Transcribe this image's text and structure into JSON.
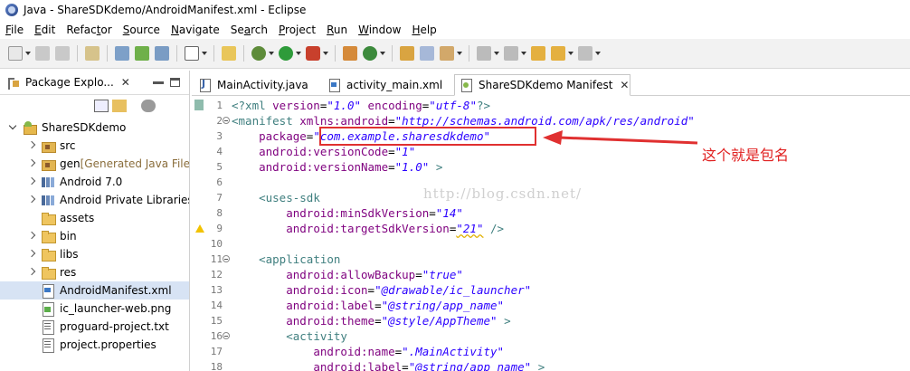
{
  "window": {
    "title": "Java - ShareSDKdemo/AndroidManifest.xml - Eclipse"
  },
  "menubar": {
    "items": [
      {
        "mnemonic": "F",
        "rest": "ile"
      },
      {
        "mnemonic": "E",
        "rest": "dit"
      },
      {
        "prefix": "Refac",
        "mnemonic": "t",
        "rest": "or"
      },
      {
        "mnemonic": "S",
        "rest": "ource"
      },
      {
        "mnemonic": "N",
        "rest": "avigate"
      },
      {
        "prefix": "Se",
        "mnemonic": "a",
        "rest": "rch"
      },
      {
        "mnemonic": "P",
        "rest": "roject"
      },
      {
        "mnemonic": "R",
        "rest": "un"
      },
      {
        "mnemonic": "W",
        "rest": "indow"
      },
      {
        "mnemonic": "H",
        "rest": "elp"
      }
    ]
  },
  "left_pane": {
    "title": "Package Explo...",
    "close": "✕",
    "tree": [
      {
        "label": "ShareSDKdemo",
        "icon": "project-icon",
        "twisty": "open",
        "depth": 0
      },
      {
        "label": "src",
        "icon": "package-folder-icon",
        "twisty": "closed",
        "depth": 1
      },
      {
        "label": "gen",
        "decor": "[Generated Java Files]",
        "icon": "package-folder-icon",
        "twisty": "closed",
        "depth": 1
      },
      {
        "label": "Android 7.0",
        "icon": "library-icon",
        "twisty": "closed",
        "depth": 1
      },
      {
        "label": "Android Private Libraries",
        "icon": "library-icon",
        "twisty": "closed",
        "depth": 1
      },
      {
        "label": "assets",
        "icon": "folder-icon",
        "twisty": "none",
        "depth": 1
      },
      {
        "label": "bin",
        "icon": "folder-icon",
        "twisty": "closed",
        "depth": 1
      },
      {
        "label": "libs",
        "icon": "folder-icon",
        "twisty": "closed",
        "depth": 1
      },
      {
        "label": "res",
        "icon": "folder-icon",
        "twisty": "closed",
        "depth": 1
      },
      {
        "label": "AndroidManifest.xml",
        "icon": "xml-file-icon",
        "twisty": "none",
        "depth": 1,
        "selected": true
      },
      {
        "label": "ic_launcher-web.png",
        "icon": "image-file-icon",
        "twisty": "none",
        "depth": 1
      },
      {
        "label": "proguard-project.txt",
        "icon": "text-file-icon",
        "twisty": "none",
        "depth": 1
      },
      {
        "label": "project.properties",
        "icon": "text-file-icon",
        "twisty": "none",
        "depth": 1
      }
    ]
  },
  "editor": {
    "tabs": [
      {
        "label": "MainActivity.java",
        "icon": "java-file-icon",
        "active": false
      },
      {
        "label": "activity_main.xml",
        "icon": "xml-file-icon",
        "active": false
      },
      {
        "label": "ShareSDKdemo Manifest",
        "icon": "manifest-icon",
        "active": true,
        "close": "✕"
      }
    ],
    "lines": [
      {
        "num": "1",
        "tokens": [
          [
            "tag",
            "<?xml "
          ],
          [
            "attr",
            "version"
          ],
          [
            "plain",
            "="
          ],
          [
            "val",
            "\"1.0\""
          ],
          [
            "plain",
            " "
          ],
          [
            "attr",
            "encoding"
          ],
          [
            "plain",
            "="
          ],
          [
            "val",
            "\"utf-8\""
          ],
          [
            "tag",
            "?>"
          ]
        ]
      },
      {
        "num": "2",
        "fold": true,
        "tokens": [
          [
            "tag",
            "<manifest "
          ],
          [
            "attr",
            "xmlns:android"
          ],
          [
            "plain",
            "="
          ],
          [
            "val",
            "\"http://schemas.android.com/apk/res/android\""
          ]
        ]
      },
      {
        "num": "3",
        "tokens": [
          [
            "plain",
            "    "
          ],
          [
            "attr",
            "package"
          ],
          [
            "plain",
            "="
          ],
          [
            "val",
            "\"com.example.sharesdkdemo\""
          ]
        ]
      },
      {
        "num": "4",
        "tokens": [
          [
            "plain",
            "    "
          ],
          [
            "attr",
            "android:versionCode"
          ],
          [
            "plain",
            "="
          ],
          [
            "val",
            "\"1\""
          ]
        ]
      },
      {
        "num": "5",
        "tokens": [
          [
            "plain",
            "    "
          ],
          [
            "attr",
            "android:versionName"
          ],
          [
            "plain",
            "="
          ],
          [
            "val",
            "\"1.0\""
          ],
          [
            "plain",
            " "
          ],
          [
            "tag",
            ">"
          ]
        ]
      },
      {
        "num": "6",
        "tokens": []
      },
      {
        "num": "7",
        "tokens": [
          [
            "plain",
            "    "
          ],
          [
            "tag",
            "<uses-sdk"
          ]
        ]
      },
      {
        "num": "8",
        "tokens": [
          [
            "plain",
            "        "
          ],
          [
            "attr",
            "android:minSdkVersion"
          ],
          [
            "plain",
            "="
          ],
          [
            "val",
            "\"14\""
          ]
        ]
      },
      {
        "num": "9",
        "warn": true,
        "tokens": [
          [
            "plain",
            "        "
          ],
          [
            "attr",
            "android:targetSdkVersion"
          ],
          [
            "plain",
            "="
          ],
          [
            "warnval",
            "\"21\""
          ],
          [
            "plain",
            " "
          ],
          [
            "tag",
            "/>"
          ]
        ]
      },
      {
        "num": "10",
        "tokens": []
      },
      {
        "num": "11",
        "fold": true,
        "tokens": [
          [
            "plain",
            "    "
          ],
          [
            "tag",
            "<application"
          ]
        ]
      },
      {
        "num": "12",
        "tokens": [
          [
            "plain",
            "        "
          ],
          [
            "attr",
            "android:allowBackup"
          ],
          [
            "plain",
            "="
          ],
          [
            "val",
            "\"true\""
          ]
        ]
      },
      {
        "num": "13",
        "tokens": [
          [
            "plain",
            "        "
          ],
          [
            "attr",
            "android:icon"
          ],
          [
            "plain",
            "="
          ],
          [
            "val",
            "\"@drawable/ic_launcher\""
          ]
        ]
      },
      {
        "num": "14",
        "tokens": [
          [
            "plain",
            "        "
          ],
          [
            "attr",
            "android:label"
          ],
          [
            "plain",
            "="
          ],
          [
            "val",
            "\"@string/app_name\""
          ]
        ]
      },
      {
        "num": "15",
        "tokens": [
          [
            "plain",
            "        "
          ],
          [
            "attr",
            "android:theme"
          ],
          [
            "plain",
            "="
          ],
          [
            "val",
            "\"@style/AppTheme\""
          ],
          [
            "plain",
            " "
          ],
          [
            "tag",
            ">"
          ]
        ]
      },
      {
        "num": "16",
        "fold": true,
        "tokens": [
          [
            "plain",
            "        "
          ],
          [
            "tag",
            "<activity"
          ]
        ]
      },
      {
        "num": "17",
        "tokens": [
          [
            "plain",
            "            "
          ],
          [
            "attr",
            "android:name"
          ],
          [
            "plain",
            "="
          ],
          [
            "val",
            "\".MainActivity\""
          ]
        ]
      },
      {
        "num": "18",
        "tokens": [
          [
            "plain",
            "            "
          ],
          [
            "attr",
            "android:label"
          ],
          [
            "plain",
            "="
          ],
          [
            "val",
            "\"@string/app_name\""
          ],
          [
            "plain",
            " "
          ],
          [
            "tag",
            ">"
          ]
        ]
      }
    ]
  },
  "annotation": {
    "text": "这个就是包名",
    "color": "#e02020"
  },
  "watermark": "http://blog.csdn.net/"
}
